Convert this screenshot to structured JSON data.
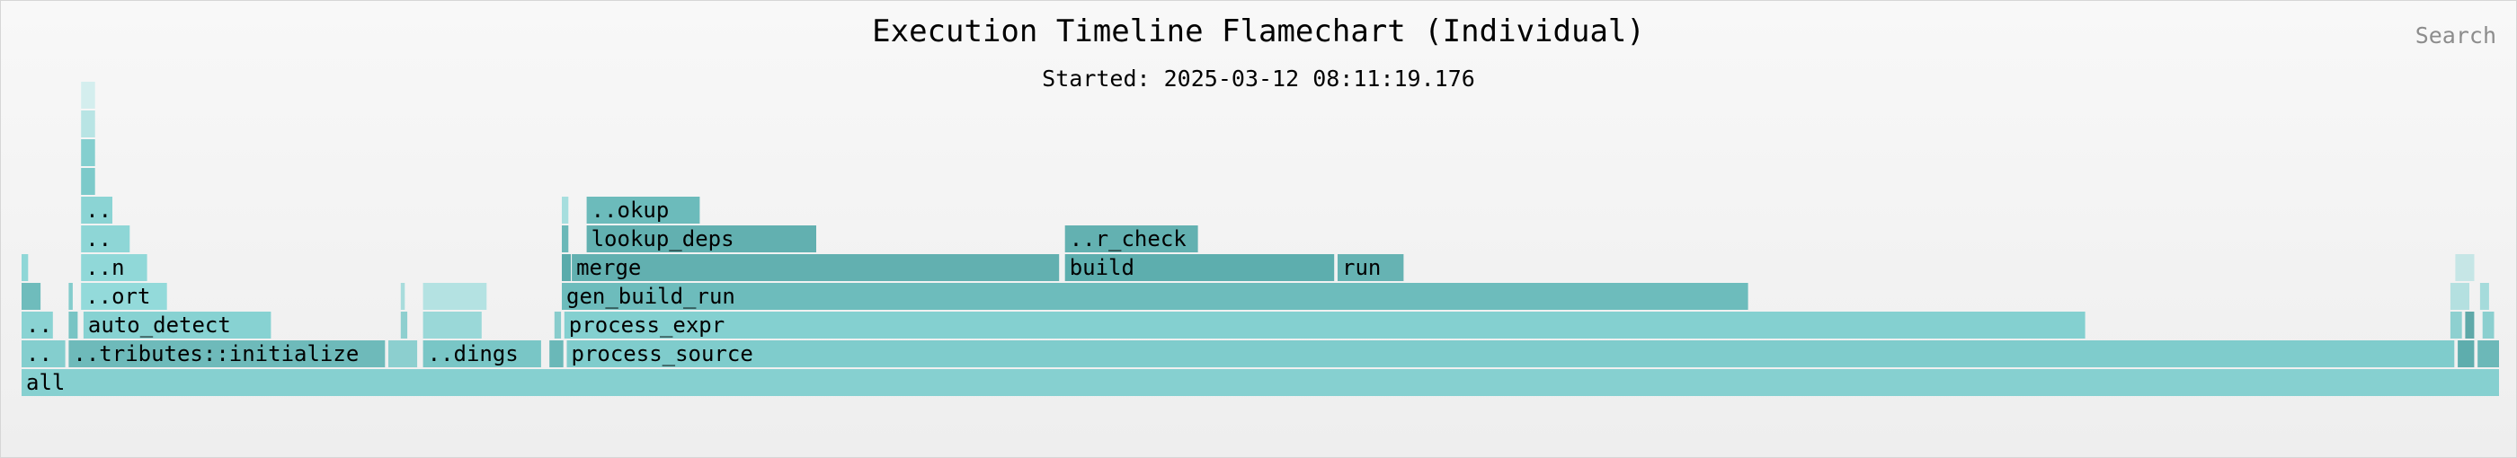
{
  "header": {
    "title": "Execution Timeline Flamechart (Individual)",
    "subtitle": "Started: 2025-03-12 08:11:19.176",
    "search_label": "Search"
  },
  "chart_data": {
    "type": "flamechart",
    "x_range": [
      0,
      1000
    ],
    "frames": [
      {
        "label": "all",
        "start": 0,
        "end": 1000,
        "depth": 0,
        "color": "#86d0d0"
      },
      {
        "label": "..",
        "start": 0,
        "end": 18,
        "depth": 1,
        "color": "#84cece"
      },
      {
        "label": "..tributes::initialize",
        "start": 19,
        "end": 147,
        "depth": 1,
        "color": "#6ebaba"
      },
      {
        "label": "",
        "start": 148,
        "end": 160,
        "depth": 1,
        "color": "#8ccfcf"
      },
      {
        "label": "..dings",
        "start": 162,
        "end": 210,
        "depth": 1,
        "color": "#79c6c6"
      },
      {
        "label": "",
        "start": 213,
        "end": 219,
        "depth": 1,
        "color": "#6ab8b8"
      },
      {
        "label": "process_source",
        "start": 220,
        "end": 982,
        "depth": 1,
        "color": "#7fcccc"
      },
      {
        "label": "",
        "start": 983,
        "end": 990,
        "depth": 1,
        "color": "#5eadad"
      },
      {
        "label": "",
        "start": 991,
        "end": 1000,
        "depth": 1,
        "color": "#6cb8b8"
      },
      {
        "label": "..",
        "start": 0,
        "end": 13,
        "depth": 2,
        "color": "#8ad3d3"
      },
      {
        "label": "",
        "start": 19,
        "end": 23,
        "depth": 2,
        "color": "#78c4c4"
      },
      {
        "label": "auto_detect",
        "start": 25,
        "end": 101,
        "depth": 2,
        "color": "#87d2d2"
      },
      {
        "label": "",
        "start": 153,
        "end": 156,
        "depth": 2,
        "color": "#8ecfcf"
      },
      {
        "label": "",
        "start": 162,
        "end": 186,
        "depth": 2,
        "color": "#9ad8d8"
      },
      {
        "label": "",
        "start": 215,
        "end": 218,
        "depth": 2,
        "color": "#88cccc"
      },
      {
        "label": "process_expr",
        "start": 219,
        "end": 833,
        "depth": 2,
        "color": "#84d0d0"
      },
      {
        "label": "",
        "start": 980,
        "end": 985,
        "depth": 2,
        "color": "#8ed0d0"
      },
      {
        "label": "",
        "start": 986,
        "end": 990,
        "depth": 2,
        "color": "#5fa9a9"
      },
      {
        "label": "",
        "start": 993,
        "end": 998,
        "depth": 2,
        "color": "#8bcfcf"
      },
      {
        "label": "",
        "start": 0,
        "end": 8,
        "depth": 3,
        "color": "#6fbcbc"
      },
      {
        "label": "",
        "start": 19,
        "end": 21,
        "depth": 3,
        "color": "#84cccc"
      },
      {
        "label": "..ort",
        "start": 24,
        "end": 59,
        "depth": 3,
        "color": "#93dada"
      },
      {
        "label": "",
        "start": 153,
        "end": 155,
        "depth": 3,
        "color": "#a8dcdc"
      },
      {
        "label": "",
        "start": 162,
        "end": 188,
        "depth": 3,
        "color": "#b4e2e2"
      },
      {
        "label": "gen_build_run",
        "start": 218,
        "end": 697,
        "depth": 3,
        "color": "#6dbcbc"
      },
      {
        "label": "",
        "start": 980,
        "end": 988,
        "depth": 3,
        "color": "#b4e0e0"
      },
      {
        "label": "",
        "start": 992,
        "end": 996,
        "depth": 3,
        "color": "#a5dbdb"
      },
      {
        "label": "",
        "start": 0,
        "end": 3,
        "depth": 4,
        "color": "#8fd7d7"
      },
      {
        "label": "..n",
        "start": 24,
        "end": 51,
        "depth": 4,
        "color": "#90d8d8"
      },
      {
        "label": "",
        "start": 218,
        "end": 222,
        "depth": 4,
        "color": "#5aabab"
      },
      {
        "label": "merge",
        "start": 222,
        "end": 419,
        "depth": 4,
        "color": "#62b0b0"
      },
      {
        "label": "build",
        "start": 421,
        "end": 530,
        "depth": 4,
        "color": "#5daeae"
      },
      {
        "label": "run",
        "start": 531,
        "end": 558,
        "depth": 4,
        "color": "#66b3b3"
      },
      {
        "label": "",
        "start": 982,
        "end": 990,
        "depth": 4,
        "color": "#c6e6e6"
      },
      {
        "label": "..",
        "start": 24,
        "end": 44,
        "depth": 5,
        "color": "#8ed6d6"
      },
      {
        "label": "",
        "start": 218,
        "end": 221,
        "depth": 5,
        "color": "#6ab8b8"
      },
      {
        "label": "lookup_deps",
        "start": 228,
        "end": 321,
        "depth": 5,
        "color": "#62b0b0"
      },
      {
        "label": "..r_check",
        "start": 421,
        "end": 475,
        "depth": 5,
        "color": "#63b1b1"
      },
      {
        "label": "..",
        "start": 24,
        "end": 37,
        "depth": 6,
        "color": "#8bd4d4"
      },
      {
        "label": "",
        "start": 218,
        "end": 221,
        "depth": 6,
        "color": "#a6dede"
      },
      {
        "label": "..okup",
        "start": 228,
        "end": 274,
        "depth": 6,
        "color": "#6cbbbb"
      },
      {
        "label": "",
        "start": 24,
        "end": 30,
        "depth": 7,
        "color": "#7ccaca"
      },
      {
        "label": "",
        "start": 24,
        "end": 30,
        "depth": 8,
        "color": "#84cfcf"
      },
      {
        "label": "",
        "start": 24,
        "end": 30,
        "depth": 9,
        "color": "#b8e4e4"
      },
      {
        "label": "",
        "start": 24,
        "end": 30,
        "depth": 10,
        "color": "#d4eeee"
      }
    ]
  }
}
